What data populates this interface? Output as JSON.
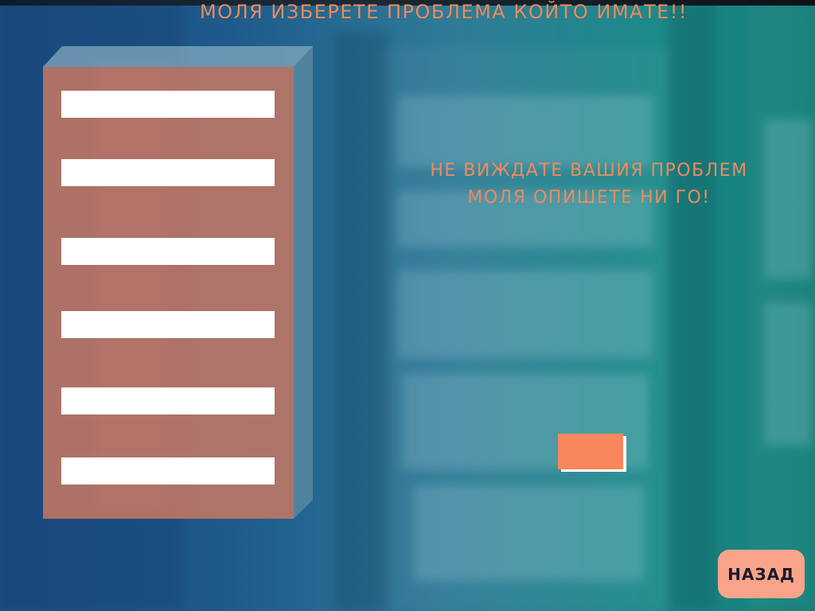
{
  "header": {
    "title": "МОЛЯ ИЗБЕРЕТЕ ПРОБЛЕМА КОЙТО ИМАТЕ!!"
  },
  "problem_panel": {
    "options": [
      {
        "label": ""
      },
      {
        "label": ""
      },
      {
        "label": ""
      },
      {
        "label": ""
      },
      {
        "label": ""
      },
      {
        "label": ""
      }
    ]
  },
  "note": {
    "line1": "НЕ ВИЖДАТЕ ВАШИЯ ПРОБЛЕМ",
    "line2": "МОЛЯ ОПИШЕТЕ НИ ГО!"
  },
  "describe_button": {
    "label": ""
  },
  "back_button": {
    "label": "НАЗАД"
  },
  "colors": {
    "accent_text": "#f08a5d",
    "panel": "#c37664",
    "describe_button": "#f9875d",
    "back_button": "#f9a489",
    "background_left": "#1b4f86",
    "background_right": "#127e78"
  }
}
